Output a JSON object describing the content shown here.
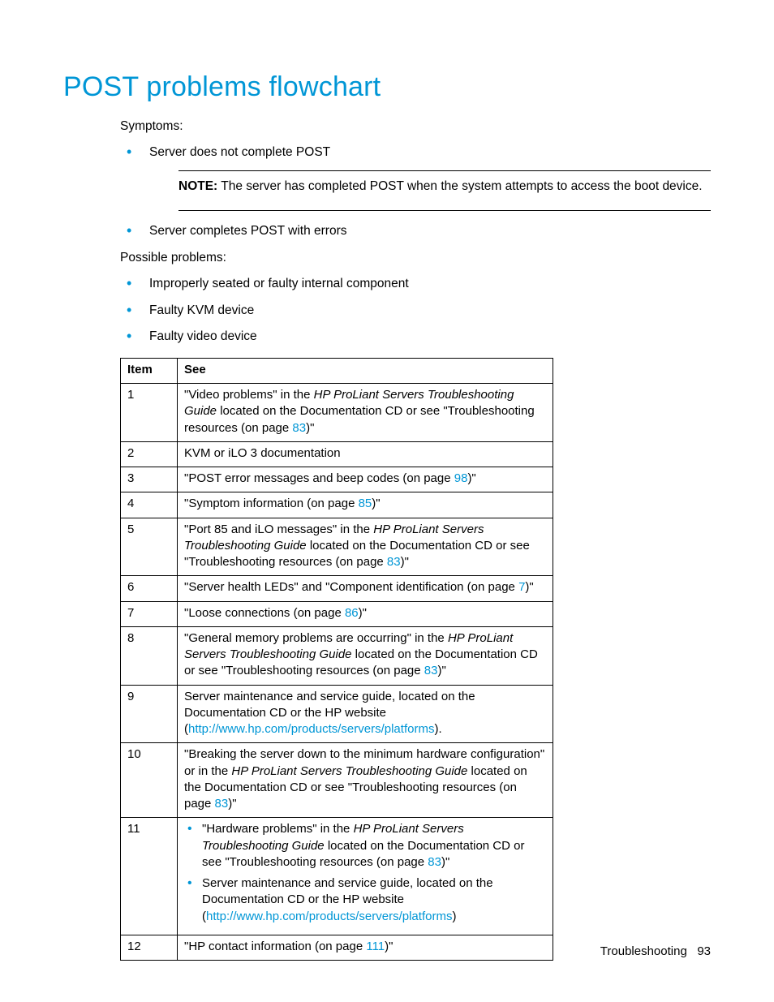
{
  "heading": "POST problems flowchart",
  "symptoms_label": "Symptoms:",
  "symptoms": [
    "Server does not complete POST",
    "Server completes POST with errors"
  ],
  "note": {
    "label": "NOTE:",
    "text": "  The server has completed POST when the system attempts to access the boot device."
  },
  "possible_label": "Possible problems:",
  "possible": [
    "Improperly seated or faulty internal component",
    "Faulty KVM device",
    "Faulty video device"
  ],
  "table": {
    "headers": {
      "item": "Item",
      "see": "See"
    },
    "rows": {
      "r1": {
        "item": "1",
        "t1": "\"Video problems\" in the ",
        "i1": "HP ProLiant Servers Troubleshooting Guide",
        "t2": " located on the Documentation CD or see \"Troubleshooting resources (on page ",
        "l1": "83",
        "t3": ")\""
      },
      "r2": {
        "item": "2",
        "t1": "KVM or iLO 3 documentation"
      },
      "r3": {
        "item": "3",
        "t1": "\"POST error messages and beep codes (on page ",
        "l1": "98",
        "t2": ")\""
      },
      "r4": {
        "item": "4",
        "t1": "\"Symptom information (on page ",
        "l1": "85",
        "t2": ")\""
      },
      "r5": {
        "item": "5",
        "t1": "\"Port 85 and iLO messages\" in the ",
        "i1": "HP ProLiant Servers Troubleshooting Guide",
        "t2": " located on the Documentation CD or see \"Troubleshooting resources (on page ",
        "l1": "83",
        "t3": ")\""
      },
      "r6": {
        "item": "6",
        "t1": "\"Server health LEDs\" and \"Component identification (on page ",
        "l1": "7",
        "t2": ")\""
      },
      "r7": {
        "item": "7",
        "t1": "\"Loose connections (on page ",
        "l1": "86",
        "t2": ")\""
      },
      "r8": {
        "item": "8",
        "t1": "\"General memory problems are occurring\" in the ",
        "i1": "HP ProLiant Servers Troubleshooting Guide",
        "t2": " located on the Documentation CD or see \"Troubleshooting resources (on page ",
        "l1": "83",
        "t3": ")\""
      },
      "r9": {
        "item": "9",
        "t1": "Server maintenance and service guide, located on the Documentation CD or the HP website (",
        "l1": "http://www.hp.com/products/servers/platforms",
        "t2": ")."
      },
      "r10": {
        "item": "10",
        "t1": "\"Breaking the server down to the minimum hardware configuration\" or in the ",
        "i1": "HP ProLiant Servers Troubleshooting Guide",
        "t2": " located on the Documentation CD or see \"Troubleshooting resources (on page ",
        "l1": "83",
        "t3": ")\""
      },
      "r11": {
        "item": "11",
        "b1": {
          "t1": "\"Hardware problems\" in the ",
          "i1": "HP ProLiant Servers Troubleshooting Guide",
          "t2": " located on the Documentation CD or see \"Troubleshooting resources (on page ",
          "l1": "83",
          "t3": ")\""
        },
        "b2": {
          "t1": "Server maintenance and service guide, located on the Documentation CD or the HP website (",
          "l1": "http://www.hp.com/products/servers/platforms",
          "t2": ")"
        }
      },
      "r12": {
        "item": "12",
        "t1": "\"HP contact information (on page ",
        "l1": "111",
        "t2": ")\""
      }
    }
  },
  "footer": {
    "section": "Troubleshooting",
    "page": "93"
  }
}
